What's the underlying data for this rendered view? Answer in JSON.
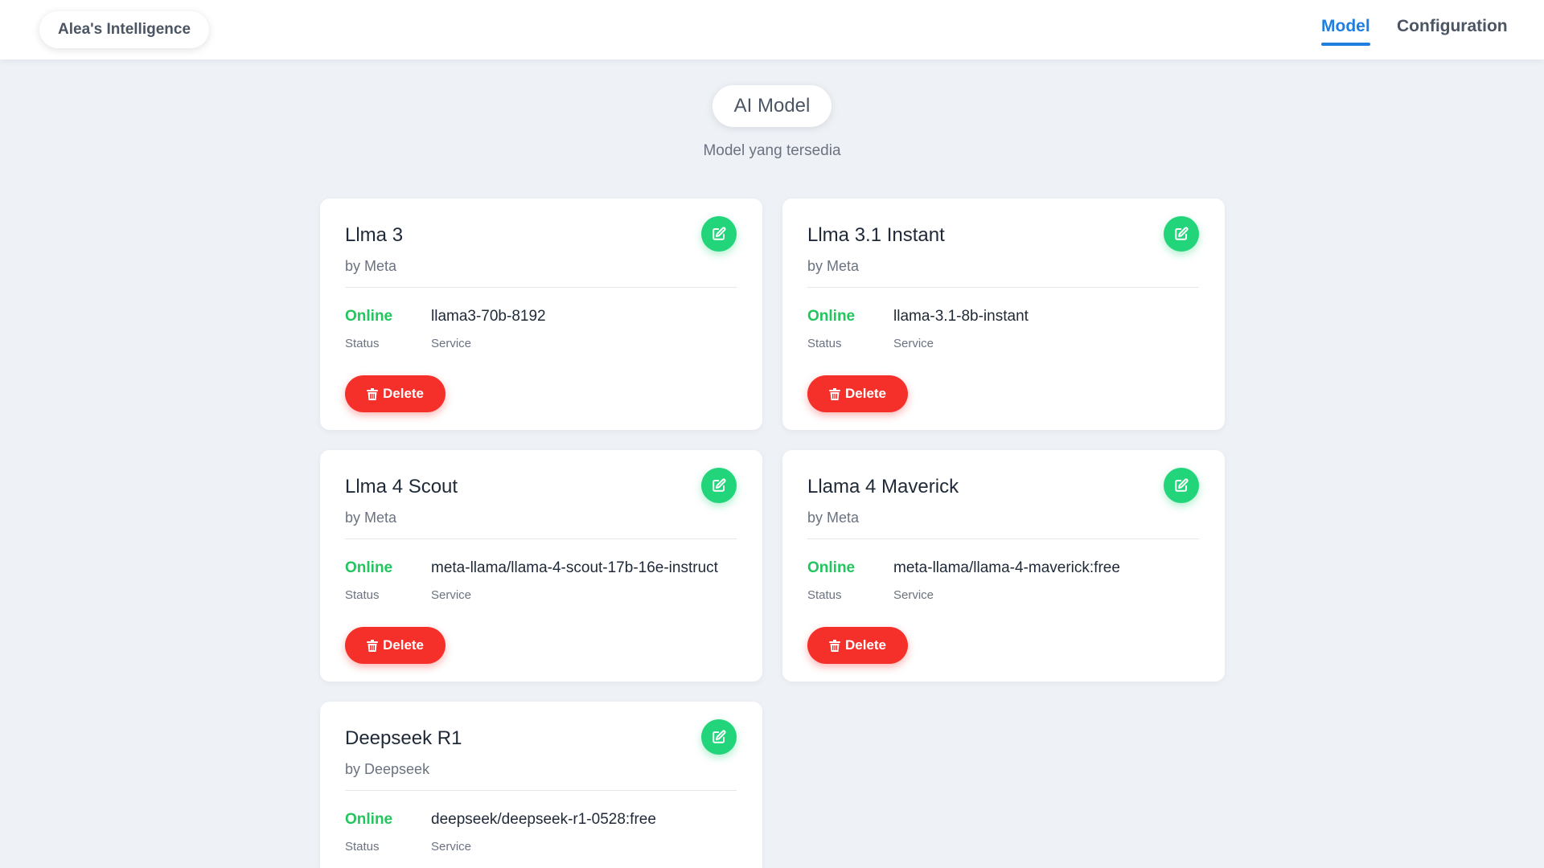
{
  "header": {
    "brand": "Alea's Intelligence",
    "nav": [
      {
        "label": "Model",
        "active": true
      },
      {
        "label": "Configuration",
        "active": false
      }
    ]
  },
  "main": {
    "title": "AI Model",
    "subtitle": "Model yang tersedia",
    "status_label": "Status",
    "service_label": "Service",
    "delete_label": "Delete",
    "models": [
      {
        "name": "Llma 3",
        "vendor": "by Meta",
        "status": "Online",
        "service": "llama3-70b-8192"
      },
      {
        "name": "Llma 3.1 Instant",
        "vendor": "by Meta",
        "status": "Online",
        "service": "llama-3.1-8b-instant"
      },
      {
        "name": "Llma 4 Scout",
        "vendor": "by Meta",
        "status": "Online",
        "service": "meta-llama/llama-4-scout-17b-16e-instruct"
      },
      {
        "name": "Llama 4 Maverick",
        "vendor": "by Meta",
        "status": "Online",
        "service": "meta-llama/llama-4-maverick:free"
      },
      {
        "name": "Deepseek R1",
        "vendor": "by Deepseek",
        "status": "Online",
        "service": "deepseek/deepseek-r1-0528:free"
      }
    ]
  },
  "colors": {
    "accent": "#1e7fe0",
    "online": "#22c55e",
    "edit": "#22d47a",
    "delete": "#f5302a",
    "background": "#eef2f7"
  },
  "icons": {
    "edit": "pencil-square-icon",
    "delete": "trash-icon"
  }
}
